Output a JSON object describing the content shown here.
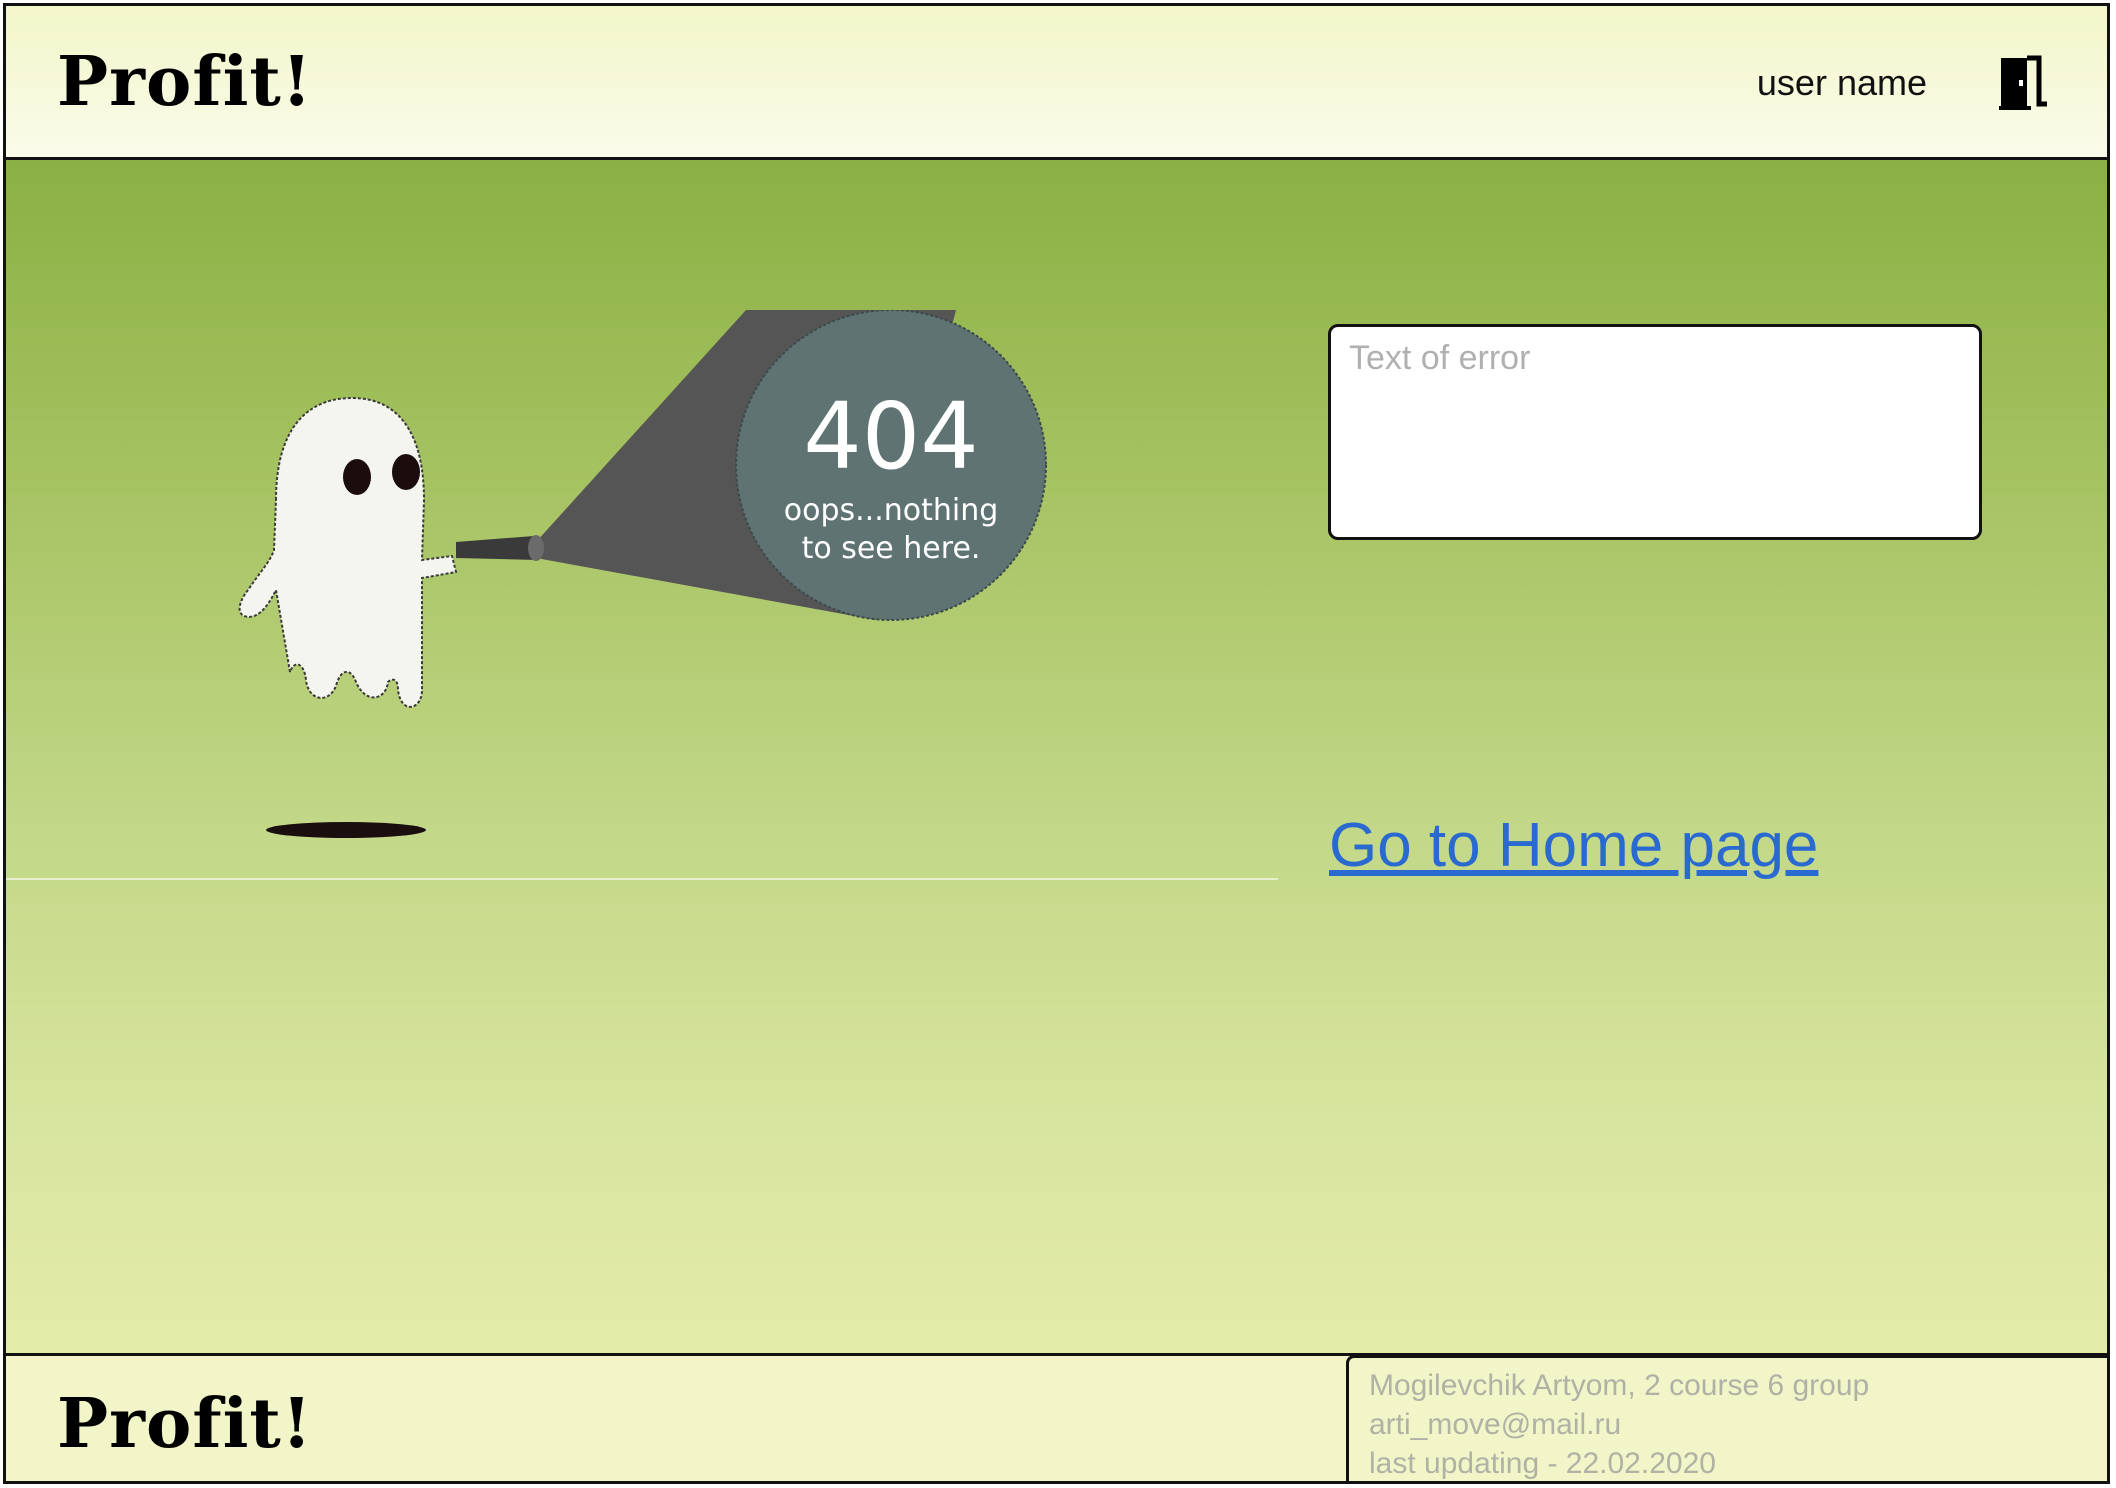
{
  "header": {
    "logo": "Profit!",
    "user_name": "user name",
    "logout_icon": "door-exit-icon"
  },
  "main": {
    "illustration": {
      "error_code": "404",
      "line1": "oops...nothing",
      "line2": "to see here."
    },
    "error_box_placeholder": "Text of error",
    "home_link": "Go to Home page"
  },
  "footer": {
    "logo": "Profit!",
    "author": "Mogilevchik Artyom, 2 course 6 group",
    "email": "arti_move@mail.ru",
    "updated": "last updating - 22.02.2020"
  },
  "colors": {
    "link": "#2a6ad0",
    "header_bg": "#f2f6c8",
    "main_top": "#8bb043",
    "main_bottom": "#e4ecaa"
  }
}
